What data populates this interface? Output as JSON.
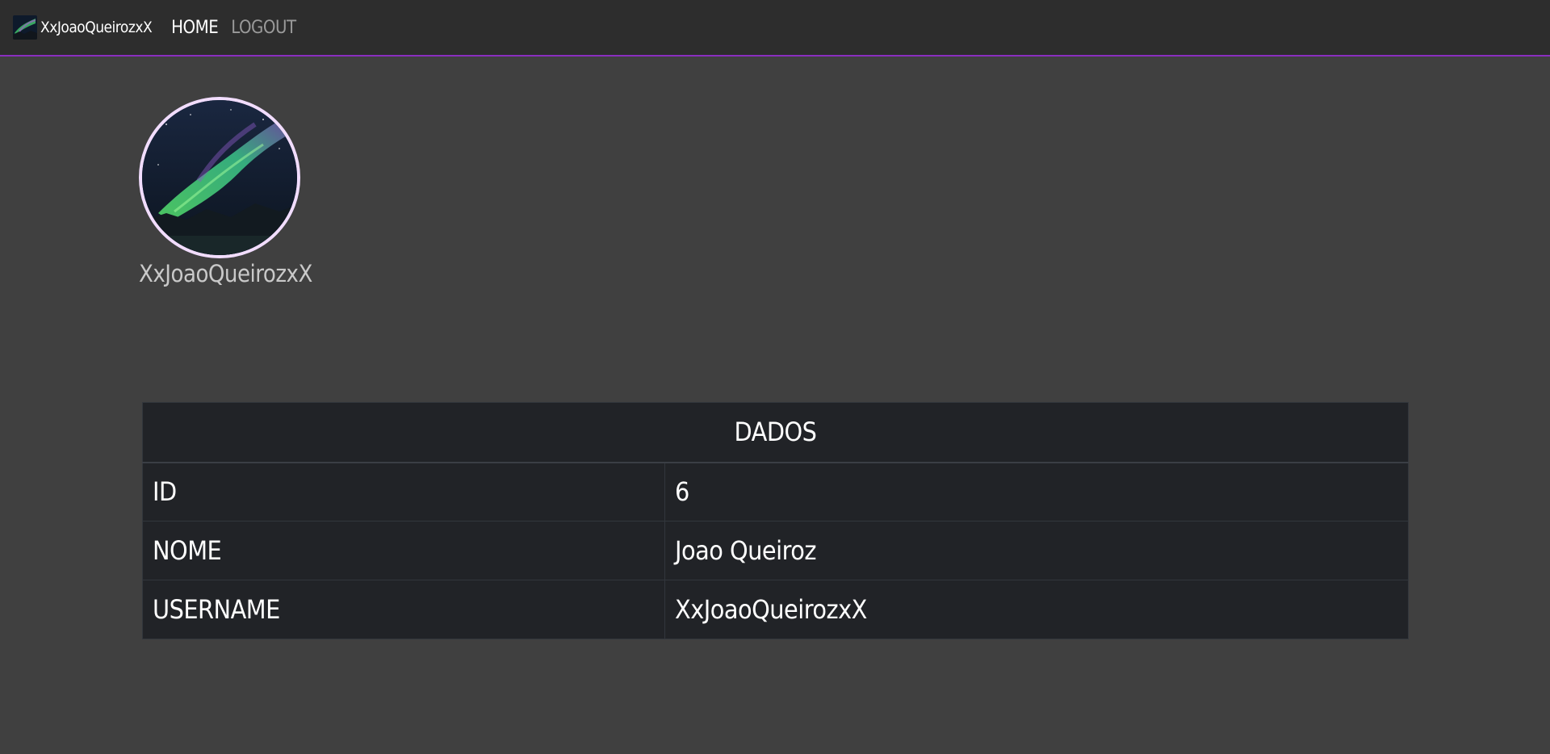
{
  "navbar": {
    "brand_label": "XxJoaoQueirozxX",
    "home_label": "HOME",
    "logout_label": "LOGOUT"
  },
  "profile": {
    "username": "XxJoaoQueirozxX"
  },
  "table": {
    "header": "DADOS",
    "rows": [
      {
        "label": "ID",
        "value": "6"
      },
      {
        "label": "NOME",
        "value": "Joao Queiroz"
      },
      {
        "label": "USERNAME",
        "value": "XxJoaoQueirozxX"
      }
    ]
  },
  "colors": {
    "background": "#404040",
    "navbar": "#2d2d2d",
    "accent": "#8a2ec0",
    "table": "#212327"
  }
}
